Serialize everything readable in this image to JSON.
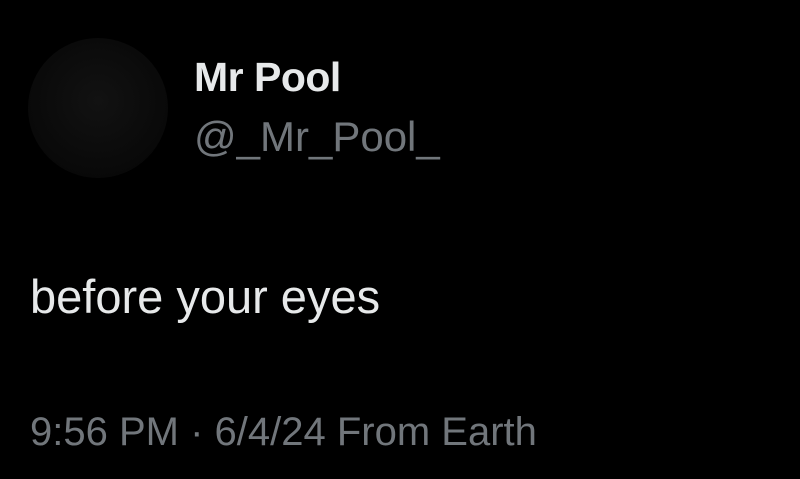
{
  "tweet": {
    "author": {
      "display_name": "Mr Pool",
      "handle": "@_Mr_Pool_",
      "avatar_icon": "profile-avatar"
    },
    "text": "before your eyes",
    "meta": {
      "time": "9:56 PM",
      "separator": " · ",
      "date": "6/4/24",
      "location": " From Earth"
    }
  },
  "colors": {
    "background": "#000000",
    "primary_text": "#e7e9ea",
    "secondary_text": "#71767b"
  }
}
